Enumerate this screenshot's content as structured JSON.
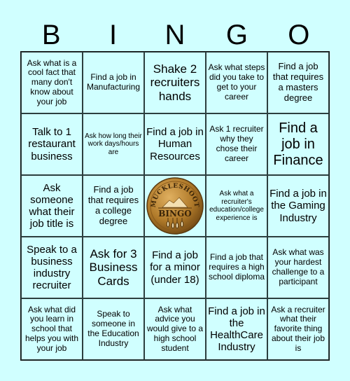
{
  "header": {
    "letters": [
      "B",
      "I",
      "N",
      "G",
      "O"
    ]
  },
  "colors": {
    "background": "#d0ffff",
    "grid_line": "#2c3e3e",
    "logo_gold": "#b07a2a"
  },
  "free_space": {
    "logo_top_text": "MUCKLESHOOT",
    "logo_bottom_text": "BINGO",
    "icon": "muckleshoot-bingo-logo"
  },
  "cells": [
    [
      "Ask what is a cool fact that many don't know about your job",
      "Find a job in Manufacturing",
      "Shake 2 recruiters hands",
      "Ask what steps did you take to get to your career",
      "Find a job that requires a masters degree"
    ],
    [
      "Talk to 1 restaurant business",
      "Ask how long their work days/hours are",
      "Find a job in Human Resources",
      "Ask 1 recruiter why they chose their career",
      "Find a job in Finance"
    ],
    [
      "Ask someone what their job title is",
      "Find a job that requires a college degree",
      "",
      "Ask what a recruiter's education/college experience is",
      "Find a job in the Gaming Industry"
    ],
    [
      "Speak to a business industry recruiter",
      "Ask for 3 Business Cards",
      "Find a job for a minor (under 18)",
      "Find a job that requires a high school diploma",
      "Ask what was your hardest challenge to a participant"
    ],
    [
      "Ask what did you learn in school that helps you with your job",
      "Speak to someone in the Education Industry",
      "Ask what advice you would give to a high school student",
      "Find a job in the HealthCare Industry",
      "Ask a recruiter what their favorite thing about their job is"
    ]
  ]
}
